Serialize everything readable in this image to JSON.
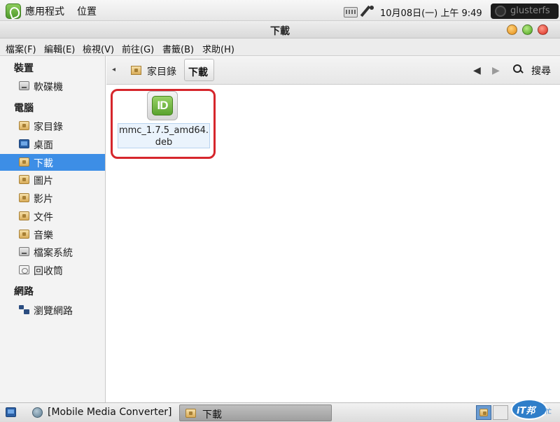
{
  "top_panel": {
    "apps_menu": "應用程式",
    "places_menu": "位置",
    "clock": "10月08日(一) 上午  9:49",
    "user": "glusterfs"
  },
  "window": {
    "title": "下載"
  },
  "menubar": [
    "檔案(F)",
    "編輯(E)",
    "檢視(V)",
    "前往(G)",
    "書籤(B)",
    "求助(H)"
  ],
  "sidebar": {
    "sections": [
      {
        "heading": "裝置",
        "items": [
          {
            "label": "軟碟機",
            "icon": "drive-icon"
          }
        ]
      },
      {
        "heading": "電腦",
        "items": [
          {
            "label": "家目錄",
            "icon": "home-folder-icon"
          },
          {
            "label": "桌面",
            "icon": "desktop-icon"
          },
          {
            "label": "下載",
            "icon": "download-folder-icon",
            "selected": true
          },
          {
            "label": "圖片",
            "icon": "pictures-folder-icon"
          },
          {
            "label": "影片",
            "icon": "videos-folder-icon"
          },
          {
            "label": "文件",
            "icon": "documents-folder-icon"
          },
          {
            "label": "音樂",
            "icon": "music-folder-icon"
          },
          {
            "label": "檔案系統",
            "icon": "filesystem-icon"
          },
          {
            "label": "回收筒",
            "icon": "trash-icon"
          }
        ]
      },
      {
        "heading": "網路",
        "items": [
          {
            "label": "瀏覽網路",
            "icon": "network-icon"
          }
        ]
      }
    ]
  },
  "location": {
    "home": "家目錄",
    "current": "下載",
    "search": "搜尋"
  },
  "files": [
    {
      "name_line1": "mmc_1.7.5_amd64.",
      "name_line2": "deb",
      "icon_text": "ID"
    }
  ],
  "taskbar": {
    "mmc": "[Mobile Media Converter]",
    "download": "下載",
    "watermark": "iT邦",
    "watermark_sub": "幫忙"
  },
  "colors": {
    "selection": "#3d8ee6",
    "highlight_ring": "#d6262c",
    "deb_green": "#5aa32f"
  }
}
